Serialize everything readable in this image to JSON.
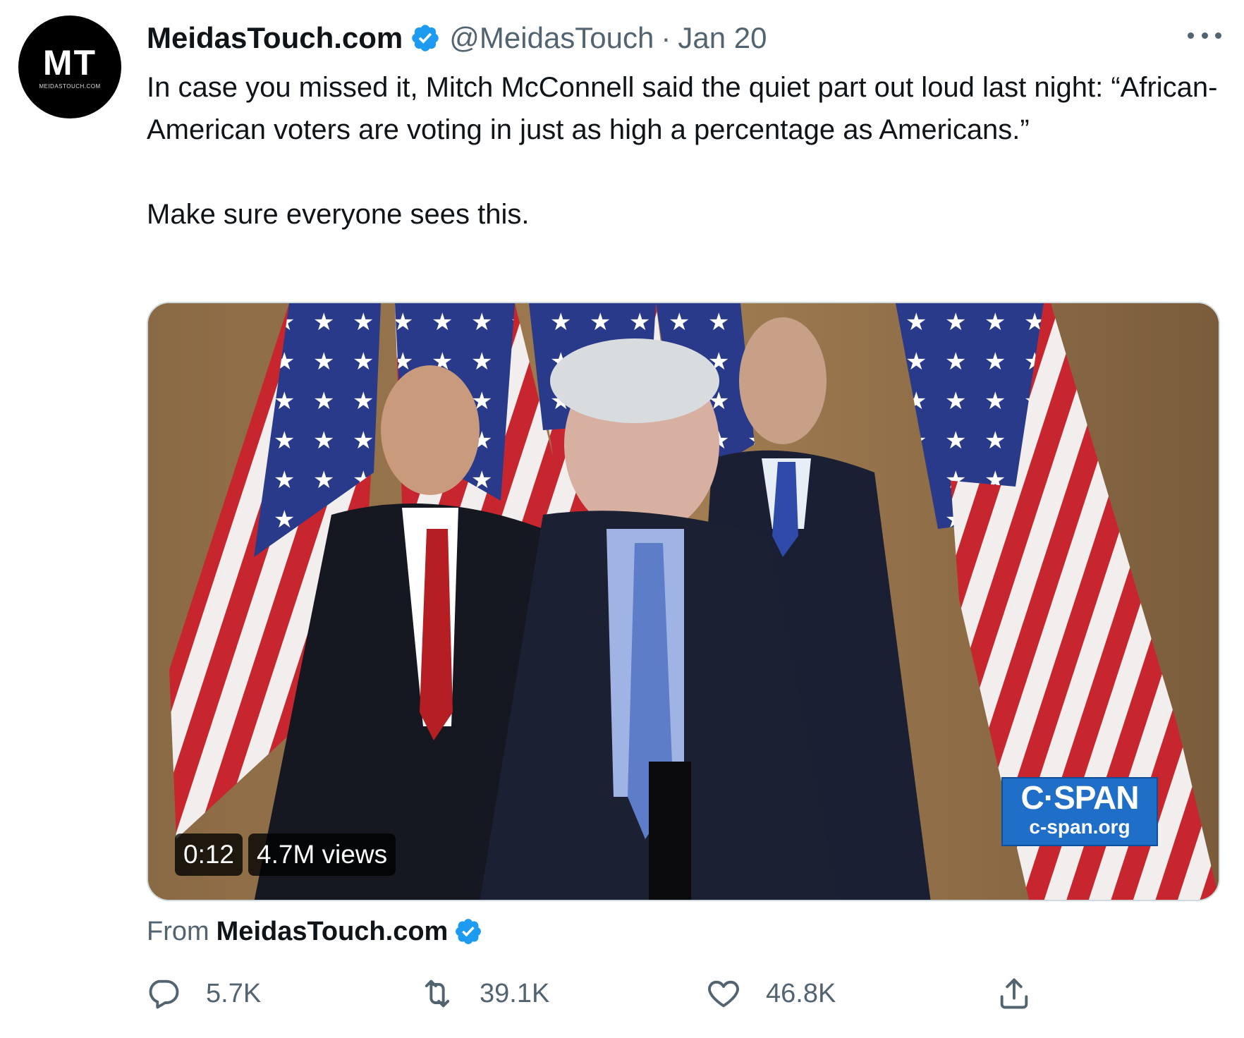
{
  "tweet": {
    "avatar": {
      "monogram": "MT",
      "subtext": "MEIDASTOUCH.COM"
    },
    "author": {
      "name": "MeidasTouch.com",
      "handle": "@MeidasTouch",
      "separator": "·",
      "date": "Jan 20",
      "verified": true
    },
    "more_icon": "more-horizontal-icon",
    "text": {
      "paragraph1": "In case you missed it, Mitch McConnell said the quiet part out loud last night: “African-American voters are voting in just as high a percentage as Americans.”",
      "paragraph2": "Make sure everyone sees this."
    },
    "video": {
      "time": "0:12",
      "views": "4.7M views",
      "watermark_title": "C·SPAN",
      "watermark_url": "c-span.org"
    },
    "source": {
      "prefix": "From",
      "name": "MeidasTouch.com",
      "verified": true
    },
    "actions": {
      "reply": {
        "icon": "reply-icon",
        "count": "5.7K"
      },
      "retweet": {
        "icon": "retweet-icon",
        "count": "39.1K"
      },
      "like": {
        "icon": "heart-icon",
        "count": "46.8K"
      },
      "share": {
        "icon": "share-icon"
      }
    },
    "colors": {
      "verified_blue": "#1d9bf0",
      "secondary_text": "#536471",
      "primary_text": "#0f1419"
    }
  }
}
